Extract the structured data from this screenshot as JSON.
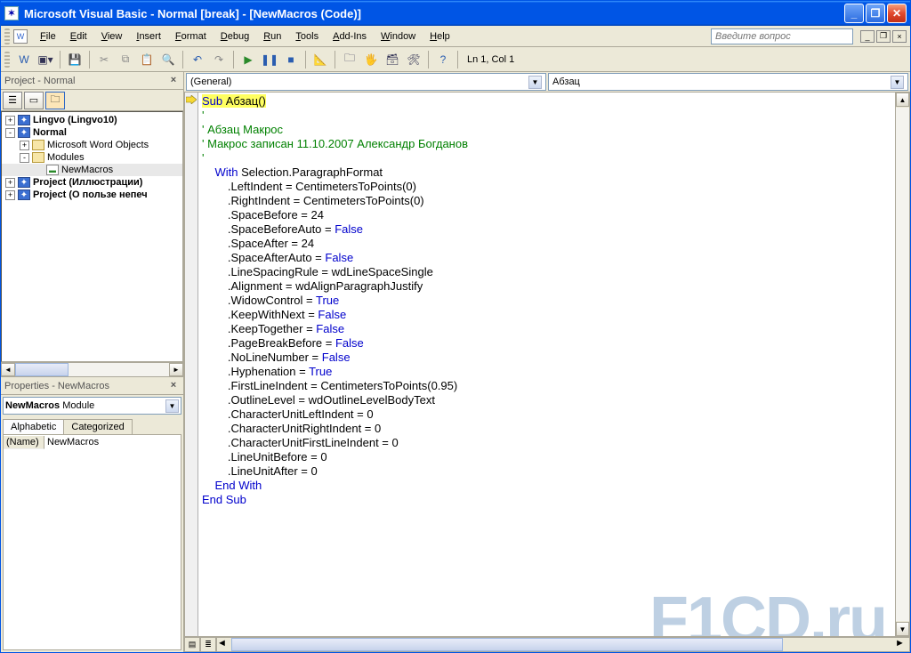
{
  "title": "Microsoft Visual Basic - Normal [break] - [NewMacros (Code)]",
  "menu": [
    "File",
    "Edit",
    "View",
    "Insert",
    "Format",
    "Debug",
    "Run",
    "Tools",
    "Add-Ins",
    "Window",
    "Help"
  ],
  "questionPlaceholder": "Введите вопрос",
  "cursorStatus": "Ln 1, Col 1",
  "projectExplorer": {
    "title": "Project - Normal",
    "nodes": [
      {
        "label": "Lingvo (Lingvo10)",
        "depth": 0,
        "twist": "+",
        "icon": "word"
      },
      {
        "label": "Normal",
        "depth": 0,
        "twist": "-",
        "icon": "word"
      },
      {
        "label": "Microsoft Word Objects",
        "depth": 1,
        "twist": "+",
        "icon": "folder"
      },
      {
        "label": "Modules",
        "depth": 1,
        "twist": "-",
        "icon": "folder"
      },
      {
        "label": "NewMacros",
        "depth": 2,
        "twist": "",
        "icon": "mod",
        "sel": true
      },
      {
        "label": "Project (Иллюстрации)",
        "depth": 0,
        "twist": "+",
        "icon": "word"
      },
      {
        "label": "Project (О пользе непеч",
        "depth": 0,
        "twist": "+",
        "icon": "word"
      }
    ]
  },
  "properties": {
    "title": "Properties - NewMacros",
    "objectName": "NewMacros",
    "objectType": "Module",
    "tabs": [
      "Alphabetic",
      "Categorized"
    ],
    "rows": [
      {
        "name": "(Name)",
        "value": "NewMacros"
      }
    ]
  },
  "dropdowns": {
    "left": "(General)",
    "right": "Абзац"
  },
  "code": {
    "lines": [
      {
        "t": "Sub",
        "k": "kw",
        "hl": true
      },
      {
        "t": " Абзац()",
        "hl": true,
        "br": true
      },
      {
        "t": "'",
        "k": "cm",
        "br": true
      },
      {
        "t": "' Абзац Макрос",
        "k": "cm",
        "br": true
      },
      {
        "t": "' Макрос записан 11.10.2007 Александр Богданов",
        "k": "cm",
        "br": true
      },
      {
        "t": "'",
        "k": "cm",
        "br": true
      },
      {
        "t": "    "
      },
      {
        "t": "With",
        "k": "kw"
      },
      {
        "t": " Selection.ParagraphFormat",
        "br": true
      },
      {
        "t": "        .LeftIndent = CentimetersToPoints(0)",
        "br": true
      },
      {
        "t": "        .RightIndent = CentimetersToPoints(0)",
        "br": true
      },
      {
        "t": "        .SpaceBefore = 24",
        "br": true
      },
      {
        "t": "        .SpaceBeforeAuto = "
      },
      {
        "t": "False",
        "k": "kw",
        "br": true
      },
      {
        "t": "        .SpaceAfter = 24",
        "br": true
      },
      {
        "t": "        .SpaceAfterAuto = "
      },
      {
        "t": "False",
        "k": "kw",
        "br": true
      },
      {
        "t": "        .LineSpacingRule = wdLineSpaceSingle",
        "br": true
      },
      {
        "t": "        .Alignment = wdAlignParagraphJustify",
        "br": true
      },
      {
        "t": "        .WidowControl = "
      },
      {
        "t": "True",
        "k": "kw",
        "br": true
      },
      {
        "t": "        .KeepWithNext = "
      },
      {
        "t": "False",
        "k": "kw",
        "br": true
      },
      {
        "t": "        .KeepTogether = "
      },
      {
        "t": "False",
        "k": "kw",
        "br": true
      },
      {
        "t": "        .PageBreakBefore = "
      },
      {
        "t": "False",
        "k": "kw",
        "br": true
      },
      {
        "t": "        .NoLineNumber = "
      },
      {
        "t": "False",
        "k": "kw",
        "br": true
      },
      {
        "t": "        .Hyphenation = "
      },
      {
        "t": "True",
        "k": "kw",
        "br": true
      },
      {
        "t": "        .FirstLineIndent = CentimetersToPoints(0.95)",
        "br": true
      },
      {
        "t": "        .OutlineLevel = wdOutlineLevelBodyText",
        "br": true
      },
      {
        "t": "        .CharacterUnitLeftIndent = 0",
        "br": true
      },
      {
        "t": "        .CharacterUnitRightIndent = 0",
        "br": true
      },
      {
        "t": "        .CharacterUnitFirstLineIndent = 0",
        "br": true
      },
      {
        "t": "        .LineUnitBefore = 0",
        "br": true
      },
      {
        "t": "        .LineUnitAfter = 0",
        "br": true
      },
      {
        "t": "    "
      },
      {
        "t": "End With",
        "k": "kw",
        "br": true
      },
      {
        "t": "End Sub",
        "k": "kw",
        "br": true
      }
    ]
  },
  "watermark": "F1CD.ru"
}
